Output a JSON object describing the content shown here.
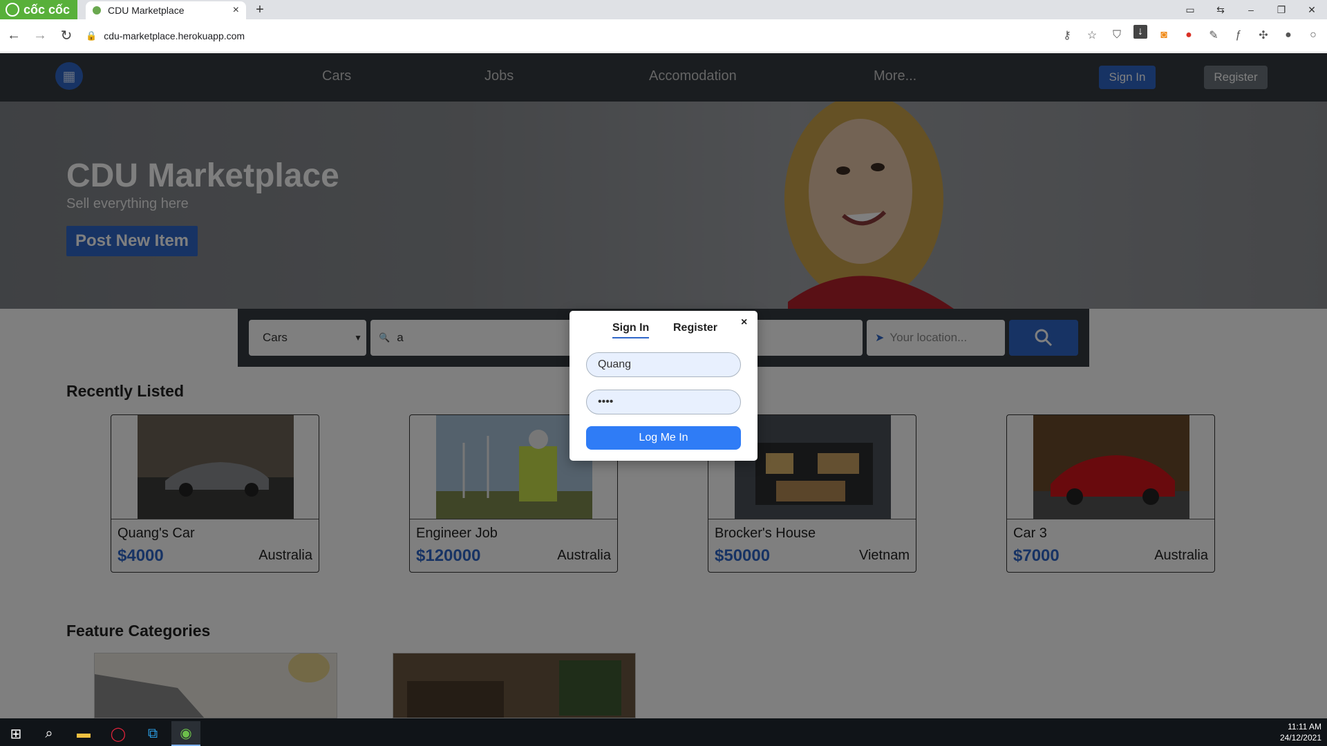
{
  "browser": {
    "brand": "cốc cốc",
    "tab_title": "CDU Marketplace",
    "tab_close": "×",
    "new_tab": "+",
    "url": "cdu-marketplace.herokuapp.com",
    "window_controls": [
      "▭",
      "⇆",
      "–",
      "❐",
      "✕"
    ]
  },
  "nav": {
    "links": [
      "Cars",
      "Jobs",
      "Accomodation",
      "More..."
    ],
    "signin": "Sign In",
    "register": "Register"
  },
  "hero": {
    "title": "CDU Marketplace",
    "subtitle": "Sell everything here",
    "button": "Post New Item"
  },
  "search": {
    "category": "Cars",
    "query": "a",
    "location_placeholder": "Your location..."
  },
  "sections": {
    "recent": "Recently Listed",
    "features": "Feature Categories"
  },
  "listings": [
    {
      "name": "Quang's Car",
      "price": "$4000",
      "location": "Australia"
    },
    {
      "name": "Engineer Job",
      "price": "$120000",
      "location": "Australia"
    },
    {
      "name": "Brocker's House",
      "price": "$50000",
      "location": "Vietnam"
    },
    {
      "name": "Car 3",
      "price": "$7000",
      "location": "Australia"
    }
  ],
  "modal": {
    "tab_signin": "Sign In",
    "tab_register": "Register",
    "close": "×",
    "username": "Quang",
    "password": "••••",
    "login_button": "Log Me In"
  },
  "taskbar": {
    "time": "11:11 AM",
    "date": "24/12/2021"
  },
  "colors": {
    "brand_blue": "#2f67c9",
    "navbar": "#343a40",
    "coccoc_green": "#58b03a"
  }
}
